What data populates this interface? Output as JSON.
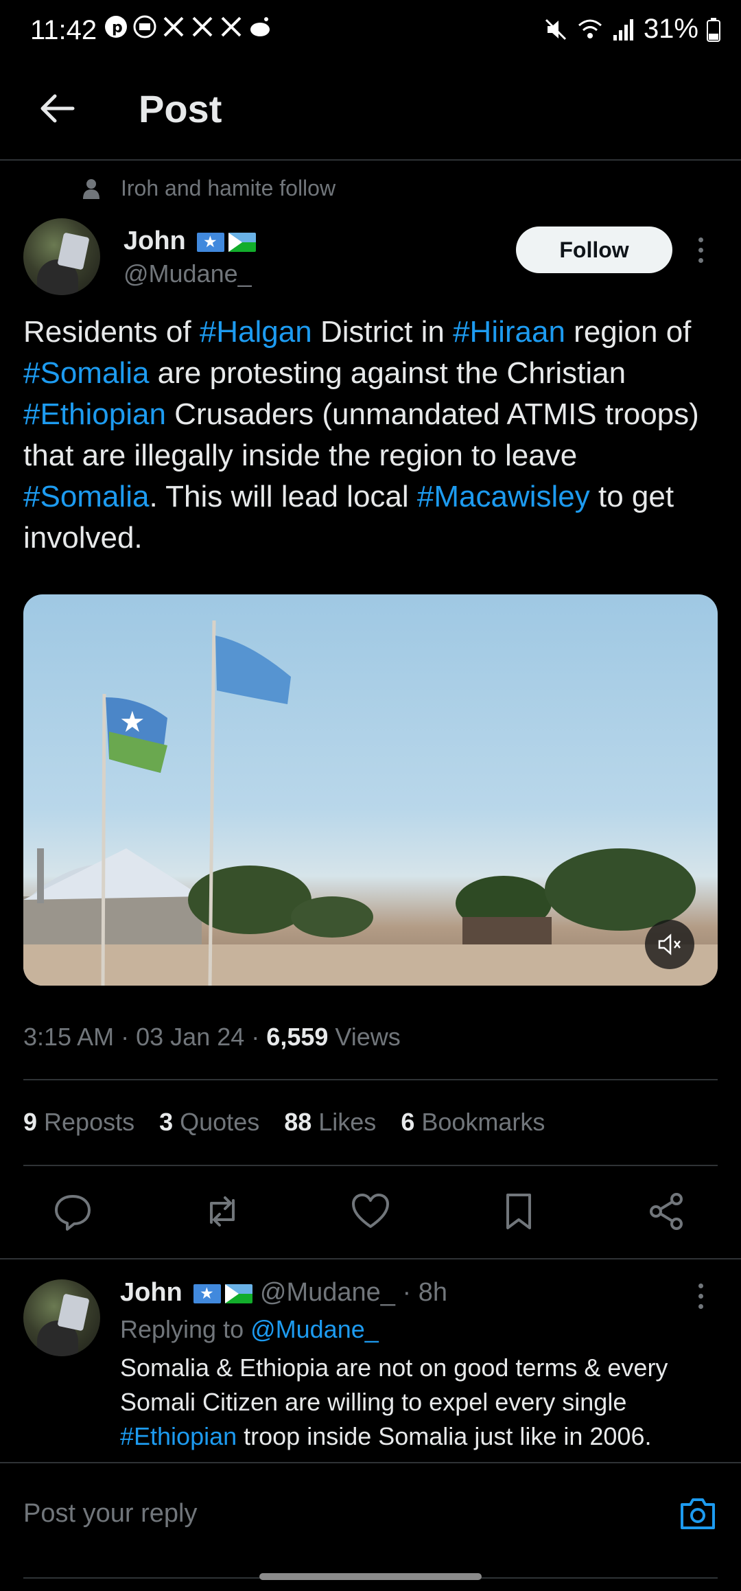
{
  "status_bar": {
    "time": "11:42",
    "battery": "31%",
    "left_icons": [
      "pinterest-icon",
      "ad-blocker-icon",
      "x-icon",
      "x-icon",
      "x-icon",
      "reddit-icon"
    ],
    "right_icons": [
      "mute-icon",
      "wifi-icon",
      "signal-icon",
      "battery-icon"
    ]
  },
  "header": {
    "title": "Post"
  },
  "social_context": "Iroh and hamite follow",
  "author": {
    "name": "John",
    "handle": "@Mudane_",
    "flags": [
      "somalia-flag",
      "djibouti-flag"
    ]
  },
  "follow_label": "Follow",
  "tweet": {
    "segments": [
      {
        "text": "Residents of ",
        "link": false
      },
      {
        "text": "#Halgan",
        "link": true
      },
      {
        "text": " District in ",
        "link": false
      },
      {
        "text": "#Hiiraan",
        "link": true
      },
      {
        "text": " region of ",
        "link": false
      },
      {
        "text": "#Somalia",
        "link": true
      },
      {
        "text": " are protesting against the Christian ",
        "link": false
      },
      {
        "text": "#Ethiopian",
        "link": true
      },
      {
        "text": " Crusaders (unmandated ATMIS troops) that are illegally inside the region to leave ",
        "link": false
      },
      {
        "text": "#Somalia",
        "link": true
      },
      {
        "text": ". This will lead local ",
        "link": false
      },
      {
        "text": "#Macawisley",
        "link": true
      },
      {
        "text": " to get involved.",
        "link": false
      }
    ]
  },
  "meta": {
    "time": "3:15 AM",
    "date": "03 Jan 24",
    "views_count": "6,559",
    "views_label": "Views",
    "sep": "·"
  },
  "stats": {
    "reposts_count": "9",
    "reposts_label": "Reposts",
    "quotes_count": "3",
    "quotes_label": "Quotes",
    "likes_count": "88",
    "likes_label": "Likes",
    "bookmarks_count": "6",
    "bookmarks_label": "Bookmarks"
  },
  "actions": [
    "reply-icon",
    "repost-icon",
    "like-icon",
    "bookmark-icon",
    "share-icon"
  ],
  "reply": {
    "name": "John",
    "handle": "@Mudane_",
    "age": "· 8h",
    "replying_prefix": "Replying to ",
    "replying_to": "@Mudane_",
    "text_a": "Somalia & Ethiopia are not on good terms & every Somali Citizen are willing to expel every single ",
    "text_link": "#Ethiopian",
    "text_b": " troop inside Somalia just like in 2006."
  },
  "composer": {
    "placeholder": "Post your reply"
  },
  "colors": {
    "background": "#000000",
    "link": "#1d9bf0",
    "muted": "#71767b",
    "text": "#e7e9ea"
  }
}
